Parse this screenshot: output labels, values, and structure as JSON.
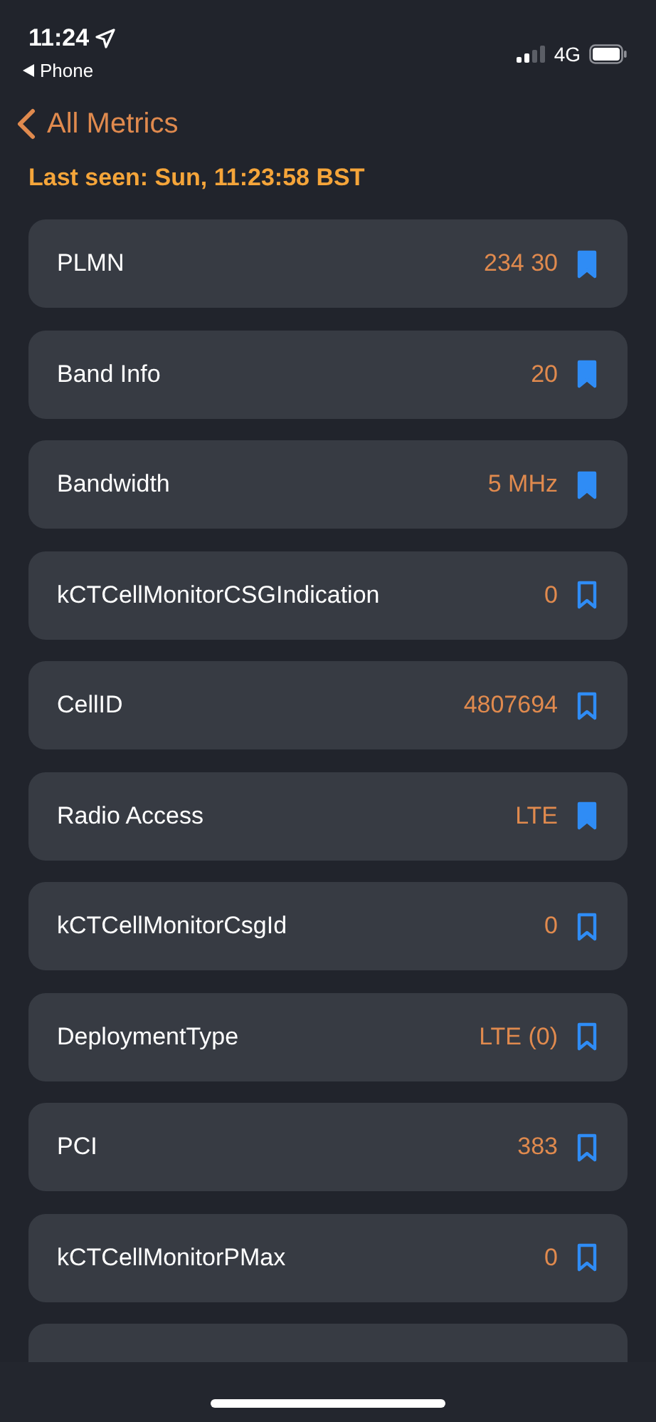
{
  "status_bar": {
    "time": "11:24",
    "back_app": "Phone",
    "network": "4G"
  },
  "nav": {
    "back_label": "All Metrics"
  },
  "last_seen": "Last seen: Sun, 11:23:58 BST",
  "metrics": [
    {
      "name": "PLMN",
      "value": "234 30",
      "bookmarked": true
    },
    {
      "name": "Band Info",
      "value": "20",
      "bookmarked": true
    },
    {
      "name": "Bandwidth",
      "value": "5 MHz",
      "bookmarked": true
    },
    {
      "name": "kCTCellMonitorCSGIndication",
      "value": "0",
      "bookmarked": false
    },
    {
      "name": "CellID",
      "value": "4807694",
      "bookmarked": false
    },
    {
      "name": "Radio Access",
      "value": "LTE",
      "bookmarked": true
    },
    {
      "name": "kCTCellMonitorCsgId",
      "value": "0",
      "bookmarked": false
    },
    {
      "name": "DeploymentType",
      "value": "LTE (0)",
      "bookmarked": false
    },
    {
      "name": "PCI",
      "value": "383",
      "bookmarked": false
    },
    {
      "name": "kCTCellMonitorPMax",
      "value": "0",
      "bookmarked": false
    }
  ]
}
